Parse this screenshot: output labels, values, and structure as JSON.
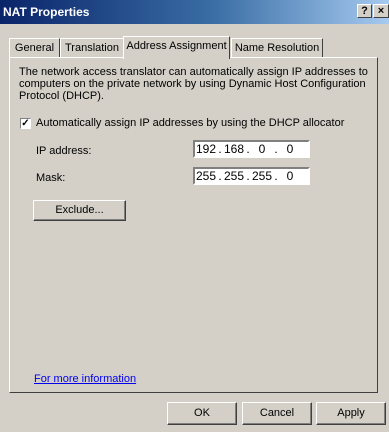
{
  "window": {
    "title": "NAT Properties",
    "help_label": "?",
    "close_label": "×"
  },
  "tabs": [
    {
      "label": "General",
      "active": false
    },
    {
      "label": "Translation",
      "active": false
    },
    {
      "label": "Address Assignment",
      "active": true
    },
    {
      "label": "Name Resolution",
      "active": false
    }
  ],
  "page": {
    "description": "The network access translator can automatically assign IP addresses to computers on the private network by using Dynamic Host Configuration Protocol (DHCP).",
    "dhcp_checkbox": {
      "label": "Automatically assign IP addresses by using the DHCP allocator",
      "checked": true,
      "mark": "✓"
    },
    "ip_address": {
      "label": "IP address:",
      "octets": [
        "192",
        "168",
        "0",
        "0"
      ]
    },
    "mask": {
      "label": "Mask:",
      "octets": [
        "255",
        "255",
        "255",
        "0"
      ]
    },
    "separator": ".",
    "exclude_button": "Exclude...",
    "info_link": "For more information"
  },
  "footer": {
    "ok": "OK",
    "cancel": "Cancel",
    "apply": "Apply"
  }
}
